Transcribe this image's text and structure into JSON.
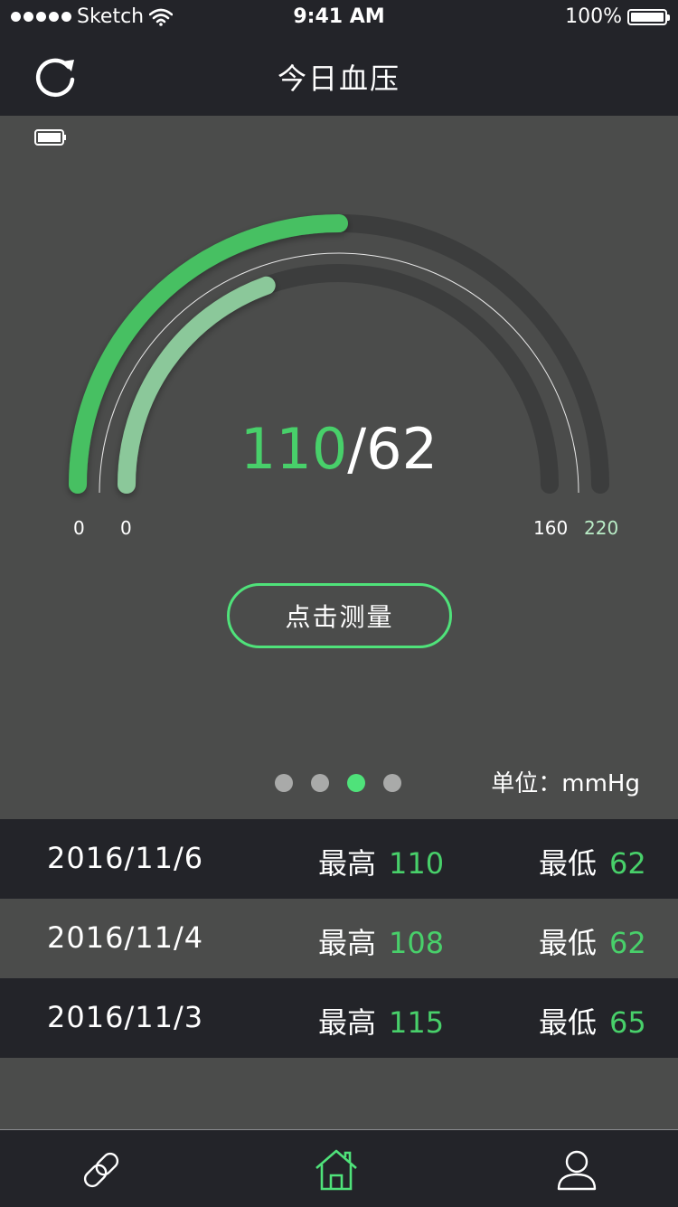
{
  "status_bar": {
    "carrier": "Sketch",
    "time": "9:41 AM",
    "battery": "100%"
  },
  "nav": {
    "title": "今日血压",
    "refresh_icon": "refresh-icon"
  },
  "gauge": {
    "systolic": "110",
    "separator": "/",
    "diastolic": "62",
    "outer_min": "0",
    "inner_min": "0",
    "inner_max": "160",
    "outer_max": "220",
    "outer_fraction": 0.5,
    "inner_fraction": 0.39,
    "colors": {
      "outer": "#46c062",
      "inner": "#8bc89a",
      "track": "#3c3d3d"
    }
  },
  "measure_button": "点击测量",
  "pager": {
    "count": 4,
    "active": 2
  },
  "unit": "单位：mmHg",
  "history": [
    {
      "date": "2016/11/6",
      "hi_label": "最高",
      "hi": "110",
      "lo_label": "最低",
      "lo": "62"
    },
    {
      "date": "2016/11/4",
      "hi_label": "最高",
      "hi": "108",
      "lo_label": "最低",
      "lo": "62"
    },
    {
      "date": "2016/11/3",
      "hi_label": "最高",
      "hi": "115",
      "lo_label": "最低",
      "lo": "65"
    }
  ],
  "tabs": [
    {
      "icon": "link-icon"
    },
    {
      "icon": "home-icon",
      "active": true
    },
    {
      "icon": "user-icon"
    }
  ],
  "accent_color": "#4fe27a"
}
